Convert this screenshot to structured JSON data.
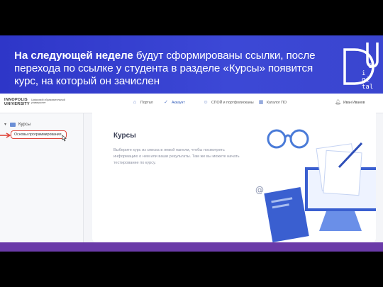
{
  "slide": {
    "heading_bold": "На следующей неделе",
    "heading_rest": " будут сформированы ссылки, после перехода по ссылке у студента в разделе «Курсы» появится курс, на который он зачислен",
    "logo_letters": [
      "D",
      "i",
      "gi",
      "tal"
    ]
  },
  "app": {
    "university_line1": "INNOPOLIS",
    "university_line2": "UNIVERSITY",
    "university_subtitle": "Цифровой образовательный университет",
    "nav": [
      {
        "label": "Портал",
        "icon": "home-icon"
      },
      {
        "label": "Аккаунт",
        "icon": "check-icon"
      },
      {
        "label": "СПОЙ и портфолиоканы",
        "icon": "people-icon"
      },
      {
        "label": "Каталог ПО",
        "icon": "grid-icon"
      }
    ],
    "active_nav_index": 1,
    "user_name": "Иван Иванов",
    "sidebar": {
      "section_label": "Курсы",
      "course_item": "Основы программирования"
    },
    "main": {
      "title": "Курсы",
      "description": "Выберите курс из списка в левой панели, чтобы посмотреть информацию о нем или ваши результаты. Там же вы можете начать тестирование по курсу."
    }
  },
  "colors": {
    "header_blue": "#3a45cf",
    "bottom_bar": "#6a3aa8",
    "highlight_red": "#e0463c",
    "accent_blue": "#2f5ab8"
  }
}
